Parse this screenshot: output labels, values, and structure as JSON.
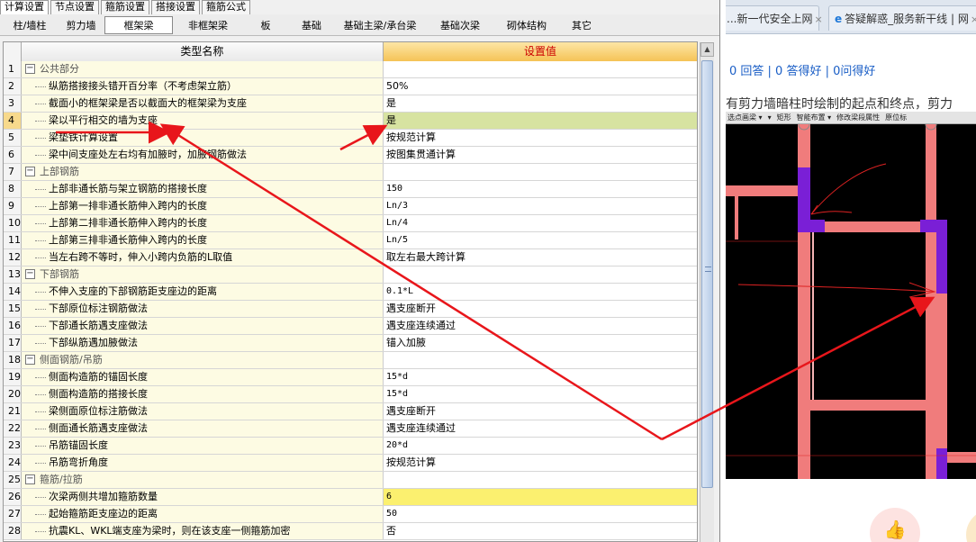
{
  "app": {
    "top_tabs": [
      "计算设置",
      "节点设置",
      "箍筋设置",
      "搭接设置",
      "箍筋公式"
    ],
    "sub_tabs": [
      "柱/墙柱",
      "剪力墙",
      "框架梁",
      "非框架梁",
      "板",
      "基础",
      "基础主梁/承台梁",
      "基础次梁",
      "砌体结构",
      "其它"
    ],
    "active_sub_tab": "框架梁",
    "columns": {
      "name": "类型名称",
      "value": "设置值"
    },
    "rows": [
      {
        "idx": "1",
        "name": "公共部分",
        "value": "",
        "group": true
      },
      {
        "idx": "2",
        "name": "纵筋搭接接头错开百分率（不考虑架立筋）",
        "value": "50%"
      },
      {
        "idx": "3",
        "name": "截面小的框架梁是否以截面大的框架梁为支座",
        "value": "是"
      },
      {
        "idx": "4",
        "name": "梁以平行相交的墙为支座",
        "value": "是",
        "selected": true
      },
      {
        "idx": "5",
        "name": "梁垫铁计算设置",
        "value": "按规范计算"
      },
      {
        "idx": "6",
        "name": "梁中间支座处左右均有加腋时，加腋钢筋做法",
        "value": "按图集贯通计算"
      },
      {
        "idx": "7",
        "name": "上部钢筋",
        "value": "",
        "group": true
      },
      {
        "idx": "8",
        "name": "上部非通长筋与架立钢筋的搭接长度",
        "value": "150"
      },
      {
        "idx": "9",
        "name": "上部第一排非通长筋伸入跨内的长度",
        "value": "Ln/3"
      },
      {
        "idx": "10",
        "name": "上部第二排非通长筋伸入跨内的长度",
        "value": "Ln/4"
      },
      {
        "idx": "11",
        "name": "上部第三排非通长筋伸入跨内的长度",
        "value": "Ln/5"
      },
      {
        "idx": "12",
        "name": "当左右跨不等时，伸入小跨内负筋的L取值",
        "value": "取左右最大跨计算"
      },
      {
        "idx": "13",
        "name": "下部钢筋",
        "value": "",
        "group": true
      },
      {
        "idx": "14",
        "name": "不伸入支座的下部钢筋距支座边的距离",
        "value": "0.1*L"
      },
      {
        "idx": "15",
        "name": "下部原位标注钢筋做法",
        "value": "遇支座断开"
      },
      {
        "idx": "16",
        "name": "下部通长筋遇支座做法",
        "value": "遇支座连续通过"
      },
      {
        "idx": "17",
        "name": "下部纵筋遇加腋做法",
        "value": "锚入加腋"
      },
      {
        "idx": "18",
        "name": "侧面钢筋/吊筋",
        "value": "",
        "group": true
      },
      {
        "idx": "19",
        "name": "侧面构造筋的锚固长度",
        "value": "15*d"
      },
      {
        "idx": "20",
        "name": "侧面构造筋的搭接长度",
        "value": "15*d"
      },
      {
        "idx": "21",
        "name": "梁侧面原位标注筋做法",
        "value": "遇支座断开"
      },
      {
        "idx": "22",
        "name": "侧面通长筋遇支座做法",
        "value": "遇支座连续通过"
      },
      {
        "idx": "23",
        "name": "吊筋锚固长度",
        "value": "20*d"
      },
      {
        "idx": "24",
        "name": "吊筋弯折角度",
        "value": "按规范计算"
      },
      {
        "idx": "25",
        "name": "箍筋/拉筋",
        "value": "",
        "group": true
      },
      {
        "idx": "26",
        "name": "次梁两侧共增加箍筋数量",
        "value": "6",
        "highlight": true
      },
      {
        "idx": "27",
        "name": "起始箍筋距支座边的距离",
        "value": "50"
      },
      {
        "idx": "28",
        "name": "抗震KL、WKL端支座为梁时，则在该支座一侧箍筋加密",
        "value": "否"
      }
    ]
  },
  "browser": {
    "tabs": [
      {
        "label": "...新一代安全上网",
        "close": "×"
      },
      {
        "label": "答疑解惑_服务新干线 | 网",
        "close": "×"
      }
    ],
    "stats": "0 回答 | 0 答得好 | 0问得好",
    "question": "有剪力墙暗柱时绘制的起点和终点，剪力",
    "cad_toolbar": [
      "选点画梁 ▾",
      "▾",
      "矩形",
      "智能布置 ▾",
      "修改梁段属性",
      "原位标"
    ]
  },
  "colors": {
    "header_value_bg": "#f5c356",
    "header_value_text": "#cc0000",
    "name_col_bg": "#fdfbe3",
    "selected_row_bg": "#d7e3a1",
    "highlight_row_bg": "#fbf06f",
    "annotation_arrow": "#e8161b",
    "beam_color": "#f07c7c",
    "column_color": "#7a1fd6",
    "link_color": "#1a5ec6"
  }
}
